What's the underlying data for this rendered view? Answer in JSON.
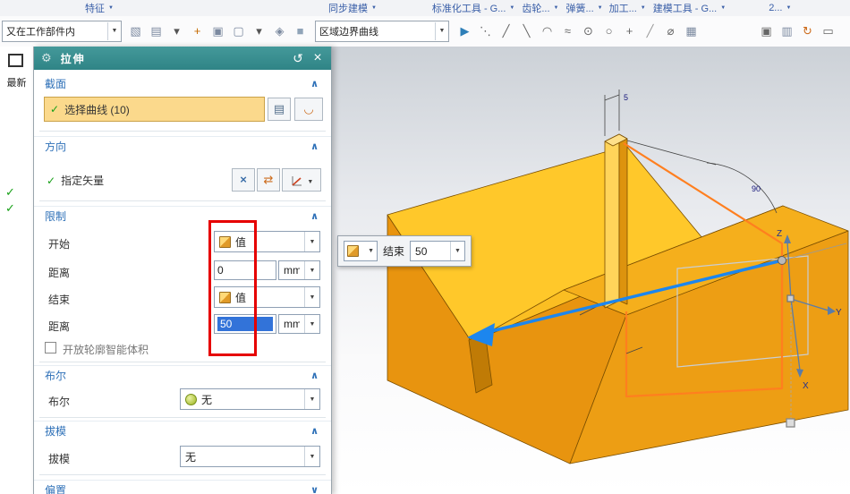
{
  "colors": {
    "header-teal": "#2f8486",
    "highlight-yellow": "#fbd98c",
    "annotation-red": "#e60000",
    "section-blue": "#2f71b8",
    "check-green": "#18a018",
    "arrow-blue": "#1c86ee",
    "model-orange": "#f0a014",
    "model-bright-yellow": "#ffc82a",
    "sketch-orange": "#ff7f1f"
  },
  "icons": {
    "caret_down": "▼",
    "chevron_up": "∧",
    "chevron_down": "∨",
    "check": "✓",
    "gear": "⚙",
    "reset": "↺",
    "close": "×",
    "vector_cross": "×",
    "swap_arrows": "⇄",
    "list_edit": "▤",
    "sketch_curve": "◡"
  },
  "ribbon": {
    "tabs": [
      {
        "name": "ribbon-group-feature",
        "label": "特征"
      },
      {
        "name": "ribbon-group-synchronous-modeling",
        "label": "同步建模"
      },
      {
        "name": "ribbon-group-standard-tools",
        "label": "标准化工具 - G..."
      },
      {
        "name": "ribbon-group-gear",
        "label": "齿轮..."
      },
      {
        "name": "ribbon-group-spring",
        "label": "弹簧..."
      },
      {
        "name": "ribbon-group-machining",
        "label": "加工..."
      },
      {
        "name": "ribbon-group-modeling-tools",
        "label": "建模工具 - G..."
      },
      {
        "name": "ribbon-group-more",
        "label": "2..."
      }
    ]
  },
  "toolbar": {
    "scope_combo": {
      "value": "又在工作部件内"
    },
    "curve_rule_combo": {
      "value": "区域边界曲线"
    },
    "left_icons": [
      {
        "name": "datum-plane-icon",
        "glyph": "▧",
        "color": "#7c8aa0"
      },
      {
        "name": "sketch-icon",
        "glyph": "▤",
        "color": "#7c8aa0"
      },
      {
        "name": "feature-more-caret-icon",
        "glyph": "▾",
        "color": "#555555"
      },
      {
        "name": "snap-point-icon",
        "glyph": "+",
        "color": "#c46a00"
      },
      {
        "name": "pattern-icon",
        "glyph": "▣",
        "color": "#7c8aa0"
      },
      {
        "name": "selection-filter-icon",
        "glyph": "▢",
        "color": "#7c8aa0"
      },
      {
        "name": "filter-caret-icon",
        "glyph": "▾",
        "color": "#555555"
      },
      {
        "name": "wireframe-view-icon",
        "glyph": "◈",
        "color": "#7c8aa0"
      },
      {
        "name": "shaded-view-icon",
        "glyph": "■",
        "color": "#90a4b8"
      }
    ],
    "mid_icons": [
      {
        "name": "direction-arrow-icon",
        "glyph": "▶",
        "color": "#2e7fb8"
      },
      {
        "name": "point-set-icon",
        "glyph": "⋱",
        "color": "#666666"
      },
      {
        "name": "line-icon",
        "glyph": "╱",
        "color": "#666666"
      },
      {
        "name": "line-alt-icon",
        "glyph": "╲",
        "color": "#666666"
      },
      {
        "name": "arc-icon",
        "glyph": "◠",
        "color": "#666666"
      },
      {
        "name": "spline-icon",
        "glyph": "≈",
        "color": "#666666"
      },
      {
        "name": "circle-center-icon",
        "glyph": "⊙",
        "color": "#666666"
      },
      {
        "name": "circle-icon",
        "glyph": "○",
        "color": "#666666"
      },
      {
        "name": "point-icon",
        "glyph": "+",
        "color": "#666666"
      },
      {
        "name": "diagonal-line-icon",
        "glyph": "╱",
        "color": "#999999"
      },
      {
        "name": "diameter-icon",
        "glyph": "⌀",
        "color": "#666666"
      },
      {
        "name": "grid-icon",
        "glyph": "▦",
        "color": "#7c8aa0"
      }
    ],
    "far_right_icons": [
      {
        "name": "record-region-icon",
        "glyph": "▣",
        "color": "#666666"
      },
      {
        "name": "snapshot-icon",
        "glyph": "▥",
        "color": "#7c8aa0"
      },
      {
        "name": "refresh-icon",
        "glyph": "↻",
        "color": "#cc6a1a"
      },
      {
        "name": "fit-window-icon",
        "glyph": "▭",
        "color": "#666666"
      }
    ]
  },
  "resource_rail": {
    "latest_label": "最新"
  },
  "dialog": {
    "title": "拉伸",
    "section": {
      "heading": "截面",
      "select_curve_label": "选择曲线 (10)"
    },
    "direction": {
      "heading": "方向",
      "specify_vector_label": "指定矢量"
    },
    "limits": {
      "heading": "限制",
      "start_label": "开始",
      "start_option": "值",
      "start_distance_label": "距离",
      "start_distance_value": "0",
      "start_unit": "mm",
      "end_label": "结束",
      "end_option": "值",
      "end_distance_label": "距离",
      "end_distance_value": "50",
      "end_unit": "mm",
      "open_profile_label": "开放轮廓智能体积"
    },
    "boolean": {
      "heading": "布尔",
      "row_label": "布尔",
      "value": "无"
    },
    "draft": {
      "heading": "拔模",
      "row_label": "拔模",
      "value": "无"
    },
    "offset": {
      "heading": "偏置"
    }
  },
  "viewport": {
    "floating": {
      "end_label": "结束",
      "end_value": "50"
    },
    "axis_labels": {
      "x": "X",
      "y": "Y",
      "z": "Z"
    },
    "dims": {
      "fin_width": "5",
      "angle": "90"
    }
  }
}
